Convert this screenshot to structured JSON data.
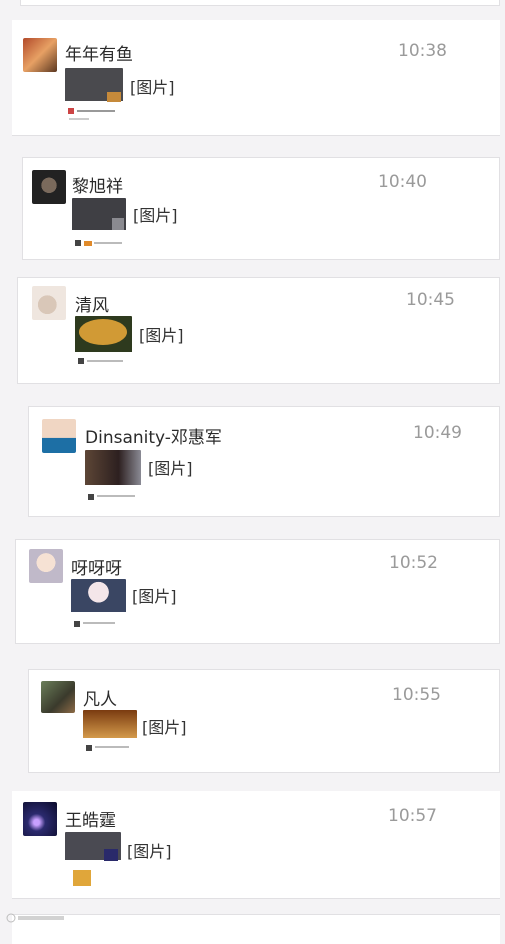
{
  "messages": [
    {
      "name": "年年有鱼",
      "time": "10:38",
      "content": "[图片]"
    },
    {
      "name": "黎旭祥",
      "time": "10:40",
      "content": "[图片]"
    },
    {
      "name": "清风",
      "time": "10:45",
      "content": "[图片]"
    },
    {
      "name": "Dinsanity-邓惠军",
      "time": "10:49",
      "content": "[图片]"
    },
    {
      "name": "呀呀呀",
      "time": "10:52",
      "content": "[图片]"
    },
    {
      "name": "凡人",
      "time": "10:55",
      "content": "[图片]"
    },
    {
      "name": "王皓霆",
      "time": "10:57",
      "content": "[图片]"
    }
  ],
  "colors": {
    "background": "#f4f3f5",
    "card": "#ffffff",
    "time": "#9a9a9a"
  }
}
